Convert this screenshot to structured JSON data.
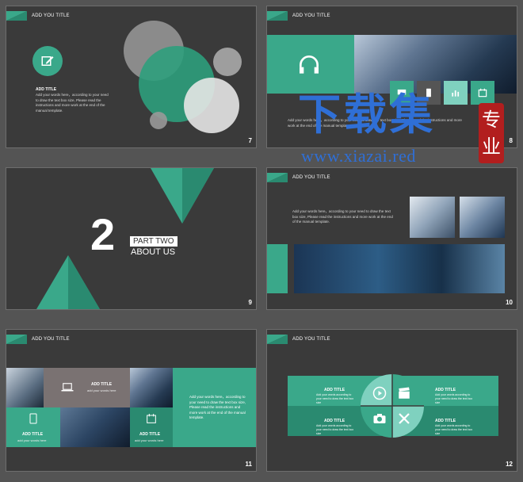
{
  "header_title": "ADD YOU TITLE",
  "body_text": "Add your words here，according to your need to draw the text box size, Please read the instructions and more work at the end of the manual template.",
  "colors": {
    "accent": "#3aa88a",
    "accent_dark": "#2a8a70",
    "bg": "#3a3a3a",
    "page": "#545454"
  },
  "slides": {
    "s7": {
      "num": "7",
      "subtitle": "ADD TITLE",
      "icon": "edit-icon"
    },
    "s8": {
      "num": "8",
      "icon": "headphones-icon"
    },
    "s9": {
      "num": "9",
      "big": "2",
      "part": "PART TWO",
      "about": "ABOUT US"
    },
    "s10": {
      "num": "10"
    },
    "s11": {
      "num": "11",
      "tiles": [
        {
          "title": "ADD TITLE",
          "text": "add your words here",
          "icon": "laptop-icon"
        },
        {
          "title": "ADD TITLE",
          "text": "add your words here",
          "icon": "tablet-icon"
        },
        {
          "title": "ADD TITLE",
          "text": "add your words here",
          "icon": "calendar-icon"
        }
      ]
    },
    "s12": {
      "num": "12",
      "items": [
        {
          "title": "ADD TITLE",
          "text": "Add your words according to your need to draw the text box size"
        },
        {
          "title": "ADD TITLE",
          "text": "Add your words according to your need to draw the text box size"
        },
        {
          "title": "ADD TITLE",
          "text": "Add your words according to your need to draw the text box size"
        },
        {
          "title": "ADD TITLE",
          "text": "Add your words according to your need to draw the text box size"
        }
      ]
    }
  },
  "watermark": {
    "chinese": "下载集",
    "url": "www.xiazai.red",
    "badge": "专业"
  }
}
